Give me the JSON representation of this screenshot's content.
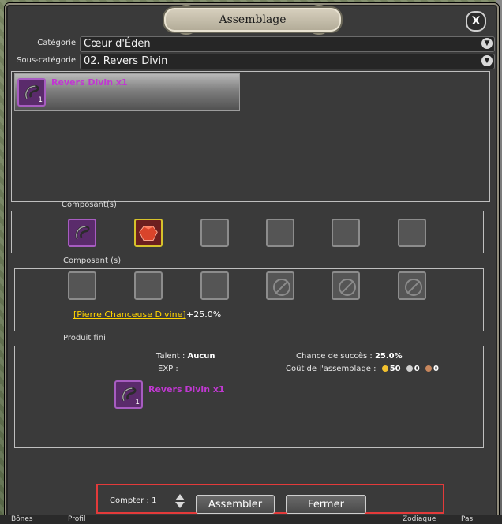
{
  "window": {
    "title": "Assemblage",
    "close_glyph": "X"
  },
  "filters": {
    "category_label": "Catégorie",
    "category_value": "Cœur d'Éden",
    "subcategory_label": "Sous-catégorie",
    "subcategory_value": "02. Revers Divin",
    "dropdown_icon": "chevron-down-icon"
  },
  "recipes": [
    {
      "name": "Revers Divin x1",
      "qty": "1",
      "icon": "revers-divin-icon"
    }
  ],
  "components_section": {
    "label": "Composant(s)",
    "slots": [
      {
        "type": "item",
        "icon": "revers-divin-icon",
        "variant": "purple"
      },
      {
        "type": "item",
        "icon": "red-gem-icon",
        "variant": "yellow"
      },
      {
        "type": "empty"
      },
      {
        "type": "empty"
      },
      {
        "type": "empty"
      },
      {
        "type": "empty"
      }
    ]
  },
  "optional_components_section": {
    "label": "Composant (s)",
    "slots": [
      {
        "type": "empty"
      },
      {
        "type": "empty"
      },
      {
        "type": "empty"
      },
      {
        "type": "blocked"
      },
      {
        "type": "blocked"
      },
      {
        "type": "blocked"
      }
    ],
    "bonus_link": "[Pierre Chanceuse Divine]",
    "bonus_value": "+25.0%"
  },
  "product": {
    "label": "Produit fini",
    "talent_label": "Talent :",
    "talent_value": "Aucun",
    "exp_label": "EXP  :",
    "success_label": "Chance de succès :",
    "success_value": "25.0%",
    "cost_label": "Coût de l'assemblage :",
    "cost_gold": "50",
    "cost_silver": "0",
    "cost_bronze": "0",
    "result_name": "Revers Divin x1",
    "result_qty": "1"
  },
  "footer": {
    "count_label": "Compter : 1",
    "assemble_button": "Assembler",
    "close_button": "Fermer"
  },
  "hud": {
    "left": "Bônes",
    "middle": "Profil",
    "right1": "Zodiaque",
    "right2": "Pas"
  },
  "colors": {
    "accent_red": "#e33a3a",
    "item_purple": "#a75cc1",
    "item_yellow": "#d6c22b",
    "bonus_link": "#ffd400",
    "recipe_text": "#c038d1"
  }
}
